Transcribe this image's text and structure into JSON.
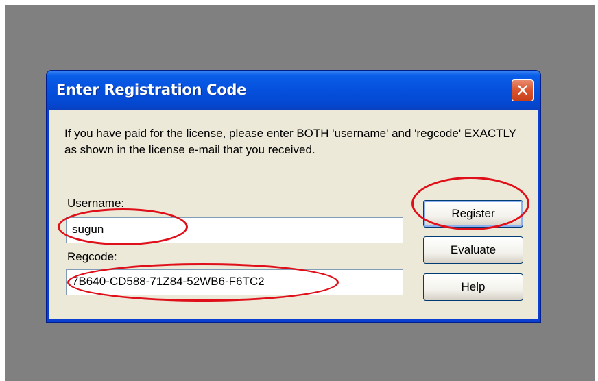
{
  "window": {
    "title": "Enter Registration Code",
    "close_icon": "close-icon"
  },
  "message": "If you have paid for the license, please enter BOTH 'username' and 'regcode' EXACTLY as shown in the license e-mail that you received.",
  "username": {
    "label": "Username:",
    "value": "sugun"
  },
  "regcode": {
    "label": "Regcode:",
    "value": "7B640-CD588-71Z84-52WB6-F6TC2"
  },
  "buttons": {
    "register": "Register",
    "evaluate": "Evaluate",
    "help": "Help"
  },
  "colors": {
    "titlebar": "#0550dd",
    "client": "#ece9d8",
    "annotation": "#e0101a",
    "close_button": "#d9542e"
  }
}
